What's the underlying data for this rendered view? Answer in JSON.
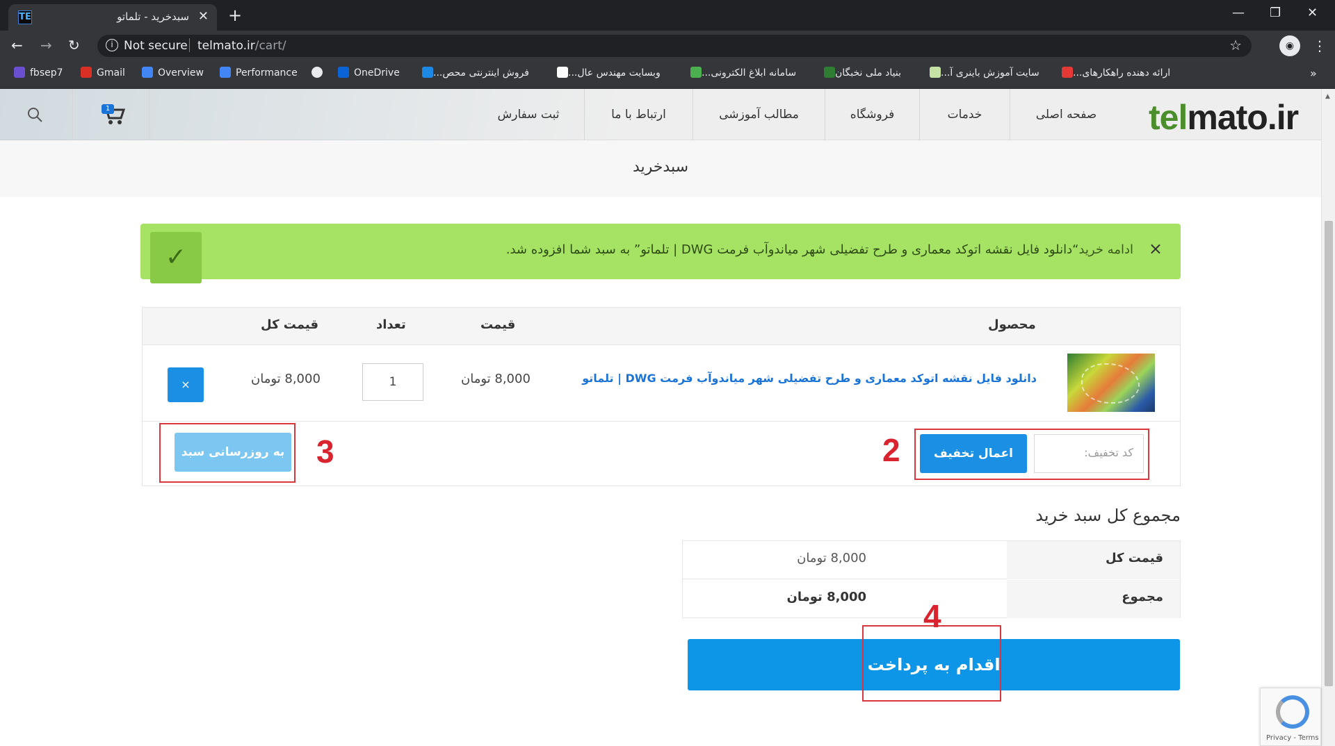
{
  "browser": {
    "tab_title": "سبدخرید - تلماتو",
    "tab_close": "✕",
    "new_tab": "+",
    "not_secure": "Not secure",
    "url_domain": "telmato.ir",
    "url_path": "/cart/",
    "bookmarks": [
      {
        "label": "fbsep7",
        "color": "#6b4fd1"
      },
      {
        "label": "Gmail",
        "color": "#d93025"
      },
      {
        "label": "Overview",
        "color": "#4285f4"
      },
      {
        "label": "Performance",
        "color": "#4285f4"
      },
      {
        "label": "",
        "color": "#e8eaed"
      },
      {
        "label": "OneDrive",
        "color": "#0a64d8"
      },
      {
        "label": "فروش اینترنتی محص...",
        "color": "#1e88e5"
      },
      {
        "label": "وبسایت مهندس عال...",
        "color": "#ffffff"
      },
      {
        "label": "سامانه ابلاغ الکترونی...",
        "color": "#4caf50"
      },
      {
        "label": "بنیاد ملی نخبگان",
        "color": "#2e7d32"
      },
      {
        "label": "سایت آموزش باینری آ...",
        "color": "#c5e1a5"
      },
      {
        "label": "ارائه دهنده راهکارهای...",
        "color": "#e53935"
      }
    ],
    "bookmarks_more": "»"
  },
  "site": {
    "logo_prefix": "tel",
    "logo_suffix": "mato.ir",
    "nav": [
      "صفحه اصلی",
      "خدمات",
      "فروشگاه",
      "مطالب آموزشی",
      "ارتباط با ما",
      "ثبت سفارش"
    ],
    "cart_count": "1"
  },
  "page": {
    "title": "سبدخرید"
  },
  "notice": {
    "continue": "ادامه خرید",
    "message": "“دانلود فایل نقشه اتوکد معماری و طرح تفضیلی شهر میاندوآب فرمت DWG | تلماتو” به سبد شما افزوده شد.",
    "check": "✓",
    "close": "×"
  },
  "cart": {
    "headers": {
      "product": "محصول",
      "price": "قیمت",
      "qty": "تعداد",
      "subtotal": "قیمت کل"
    },
    "item": {
      "name": "دانلود فایل نقشه اتوکد معماری و طرح تفضیلی شهر میاندوآب فرمت DWG | تلماتو",
      "price": "8,000 تومان",
      "qty": "1",
      "subtotal": "8,000 تومان",
      "remove": "×"
    },
    "coupon_placeholder": "کد تخفیف:",
    "apply_coupon": "اعمال تخفیف",
    "update_cart": "به روزرسانی سبد",
    "annotations": {
      "coupon": "2",
      "update": "3",
      "checkout": "4"
    }
  },
  "totals": {
    "title": "مجموع کل سبد خرید",
    "subtotal_label": "قیمت کل",
    "subtotal_value": "8,000 تومان",
    "total_label": "مجموع",
    "total_value": "8,000 تومان",
    "checkout": "اقدام به پرداخت"
  },
  "recaptcha": {
    "text": "Privacy - Terms"
  },
  "colors": {
    "accent": "#1a8fe3",
    "notice_bg": "#a6e364",
    "annotation": "#d9232e"
  }
}
